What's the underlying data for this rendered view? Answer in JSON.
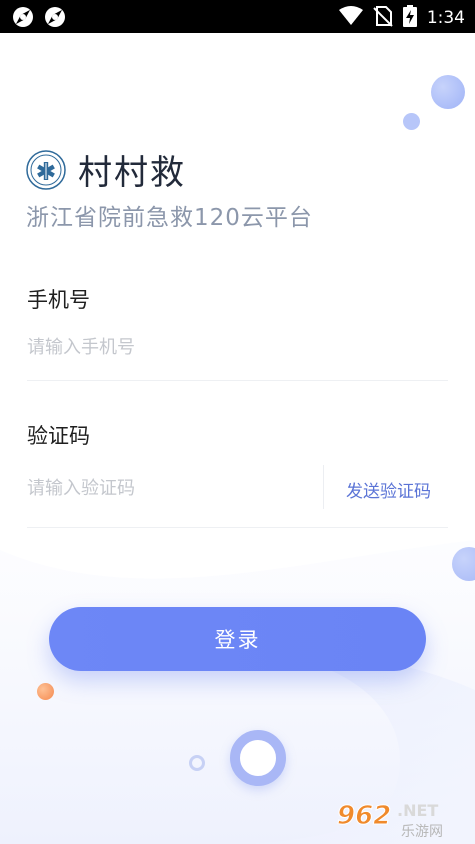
{
  "status_bar": {
    "time": "1:34",
    "icons": [
      "aperture-icon",
      "aperture-icon",
      "wifi-icon",
      "no-sim-icon",
      "battery-charging-icon"
    ]
  },
  "brand": {
    "logo_icon": "emergency-star-of-life-logo",
    "name": "村村救",
    "subtitle": "浙江省院前急救120云平台"
  },
  "form": {
    "phone": {
      "label": "手机号",
      "placeholder": "请输入手机号",
      "value": ""
    },
    "code": {
      "label": "验证码",
      "placeholder": "请输入验证码",
      "value": "",
      "send_label": "发送验证码"
    },
    "login_label": "登录"
  },
  "colors": {
    "accent": "#6d87f6",
    "link": "#5b74d6",
    "title": "#222a3a",
    "subtitle": "#8c97ab",
    "placeholder": "#c4c7cd"
  },
  "watermark": {
    "text": "962.NET",
    "subtext": "乐游网"
  }
}
